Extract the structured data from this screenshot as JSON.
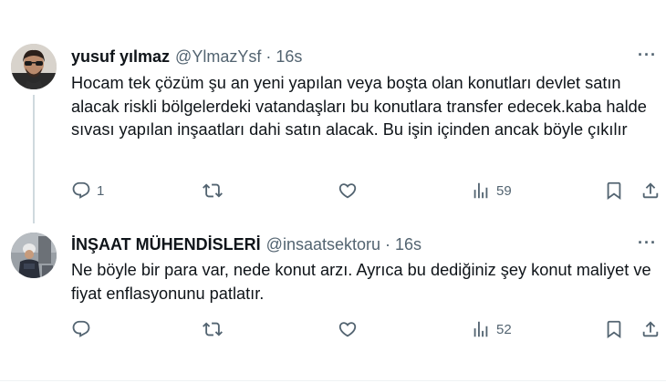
{
  "tweets": [
    {
      "name": "yusuf yılmaz",
      "handle": "@YlmazYsf",
      "separator": "·",
      "time": "16s",
      "more": "···",
      "text": "Hocam tek çözüm şu an yeni yapılan veya boşta olan konutları devlet satın alacak riskli bölgelerdeki vatandaşları bu konutlara transfer edecek.kaba halde sıvası yapılan inşaatları dahi satın alacak. Bu işin içinden ancak böyle çıkılır",
      "replies": "1",
      "retweets": "",
      "likes": "",
      "views": "59",
      "avatar_icon": "person-with-glasses-photo"
    },
    {
      "name": "İNŞAAT MÜHENDİSLERİ",
      "handle": "@insaatsektoru",
      "separator": "·",
      "time": "16s",
      "more": "···",
      "text": "Ne böyle bir para var, nede konut arzı. Ayrıca bu dediğiniz şey konut maliyet ve fiyat enflasyonunu patlatır.",
      "replies": "",
      "retweets": "",
      "likes": "",
      "views": "52",
      "avatar_icon": "construction-worker-photo"
    }
  ],
  "colors": {
    "text": "#0f1419",
    "muted": "#536471",
    "line": "#cfd9de",
    "divider": "#eff3f4"
  }
}
